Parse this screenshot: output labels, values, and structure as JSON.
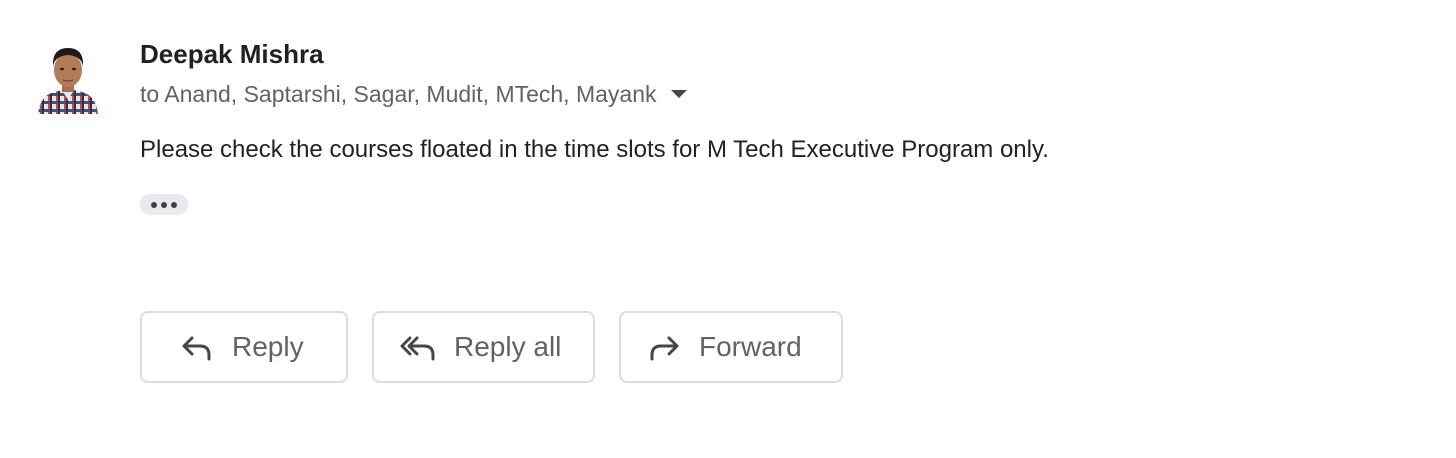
{
  "message": {
    "sender": {
      "name": "Deepak Mishra",
      "avatar": "profile-photo"
    },
    "recipients_text": "to Anand, Saptarshi, Sagar, Mudit, MTech, Mayank",
    "details_icon": "caret-down-icon",
    "body": "Please check the courses floated in the time slots for M Tech Executive Program only.",
    "trimmed_content_icon": "more-horizontal-icon"
  },
  "actions": {
    "reply": {
      "label": "Reply",
      "icon": "reply-icon"
    },
    "reply_all": {
      "label": "Reply all",
      "icon": "reply-all-icon"
    },
    "forward": {
      "label": "Forward",
      "icon": "forward-icon"
    }
  },
  "colors": {
    "sender_name": "#202124",
    "secondary_text": "#5f6368",
    "body_text": "#222222",
    "button_border": "#dadce0",
    "trim_button_bg": "#e8eaed"
  }
}
